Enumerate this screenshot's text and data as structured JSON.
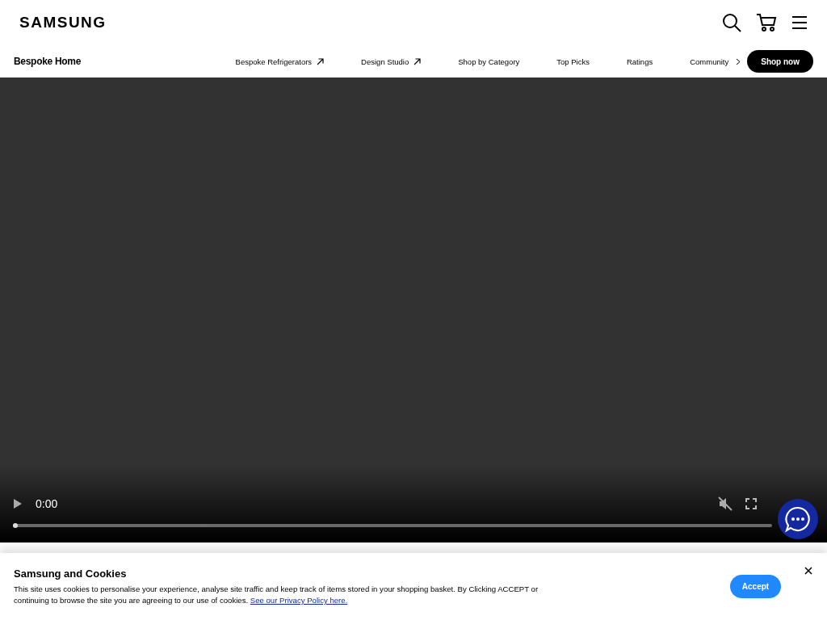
{
  "header": {
    "logo": "SAMSUNG"
  },
  "subnav": {
    "title": "Bespoke Home",
    "items": [
      {
        "label": "Bespoke Refrigerators",
        "external": true
      },
      {
        "label": "Design Studio",
        "external": true
      },
      {
        "label": "Shop by Category",
        "external": false
      },
      {
        "label": "Top Picks",
        "external": false
      },
      {
        "label": "Ratings",
        "external": false
      },
      {
        "label": "Community",
        "external": false
      }
    ],
    "cta": "Shop now"
  },
  "video": {
    "time": "0:00",
    "muted": true,
    "progress": {
      "level": 0
    }
  },
  "cookie_banner": {
    "title": "Samsung and Cookies",
    "text": "This site uses cookies to personalise your experience, analyse site traffic and keep track of items stored in your shopping basket. By Clicking ACCEPT or continuing to browse the site you are agreeing to our use of cookies.",
    "link": "See our Privacy Policy here.",
    "accept": "Accept"
  }
}
